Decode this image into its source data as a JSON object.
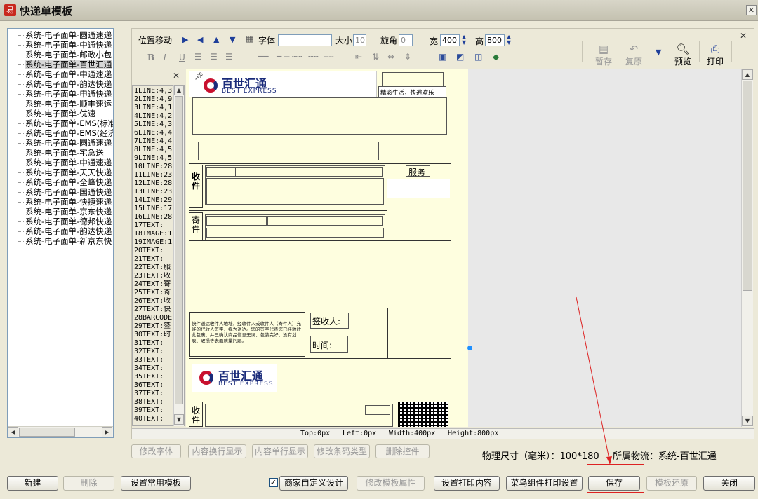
{
  "window": {
    "title": "快递单模板",
    "icon": "app-logo-icon",
    "close": "✕"
  },
  "templates": [
    "系统-电子面单-圆通速递",
    "系统-电子面单-中通快递",
    "系统-电子面单-邮政小包",
    "系统-电子面单-百世汇通",
    "系统-电子面单-中通速递",
    "系统-电子面单-韵达快递",
    "系统-电子面单-申通快递",
    "系统-电子面单-顺丰速运",
    "系统-电子面单-优速",
    "系统-电子面单-EMS(标准",
    "系统-电子面单-EMS(经济",
    "系统-电子面单-圆通速递",
    "系统-电子面单-宅急送",
    "系统-电子面单-中通速递",
    "系统-电子面单-天天快递",
    "系统-电子面单-全峰快递",
    "系统-电子面单-国通快递",
    "系统-电子面单-快捷速递",
    "系统-电子面单-京东快递",
    "系统-电子面单-德邦快递",
    "系统-电子面单-韵达快递",
    "系统-电子面单-新京东快"
  ],
  "toolbar": {
    "position_move": "位置移动",
    "font_label": "字体",
    "size_label": "大小",
    "size_value": "10",
    "rotation_label": "旋角",
    "rotation_value": "0",
    "width_label": "宽",
    "width_value": "400",
    "height_label": "高",
    "height_value": "800",
    "save": "暂存",
    "restore": "复原",
    "preview": "预览",
    "print": "打印"
  },
  "elements": [
    "1LINE:4,3",
    "2LINE:4,9",
    "3LINE:4,1",
    "4LINE:4,2",
    "5LINE:4,3",
    "6LINE:4,4",
    "7LINE:4,4",
    "8LINE:4,5",
    "9LINE:4,5",
    "10LINE:28",
    "11LINE:23",
    "12LINE:28",
    "13LINE:23",
    "14LINE:29",
    "15LINE:17",
    "16LINE:28",
    "17TEXT:",
    "18IMAGE:1",
    "19IMAGE:1",
    "20TEXT:",
    "21TEXT:",
    "22TEXT:服",
    "23TEXT:收",
    "24TEXT:寄",
    "25TEXT:寄",
    "26TEXT:收",
    "27TEXT:快",
    "28BARCODE",
    "29TEXT:签",
    "30TEXT:时",
    "31TEXT:",
    "32TEXT:",
    "33TEXT:",
    "34TEXT:",
    "35TEXT:",
    "36TEXT:",
    "37TEXT:",
    "38TEXT:",
    "39TEXT:",
    "40TEXT:"
  ],
  "label": {
    "logo_cn": "百世汇通",
    "logo_en": "BEST EXPRESS",
    "slogan": "精彩生活，快递欢乐",
    "service": "服务",
    "receiver_vertical": "收件",
    "sender_vertical": "寄件",
    "notice": "快件送达收件人地址，经收件人或收件人（寄件人）允许的代收人签字，视为送达。您的签字代表您已经验收此包裹，并已确认商品信息无误、包装完好、没有划痕、破损等表面质量问题。",
    "signer": "签收人:",
    "time": "时间:",
    "receiver_vertical2": "收件"
  },
  "status": {
    "top": "Top:0px",
    "left": "Left:0px",
    "width": "Width:400px",
    "height": "Height:800px"
  },
  "actions": {
    "modify_font": "修改字体",
    "wrap_display": "内容换行显示",
    "single_line": "内容单行显示",
    "barcode_type": "修改条码类型",
    "delete_control": "删除控件"
  },
  "info": {
    "physical_size_label": "物理尺寸（毫米）：",
    "physical_size_value": "100*180",
    "logistics_label": "所属物流：",
    "logistics_value": "系统-百世汇通"
  },
  "bottom": {
    "new": "新建",
    "delete": "删除",
    "set_common": "设置常用模板",
    "merchant_custom": "商家自定义设计",
    "merchant_checked": "✓",
    "modify_props": "修改模板属性",
    "print_content": "设置打印内容",
    "cainiao": "菜鸟组件打印设置",
    "save": "保存",
    "restore": "模板还原",
    "close": "关闭"
  },
  "colors": {
    "highlight": "#dd2222",
    "paper": "#fefedf",
    "brand": "#1a2b7a",
    "brand_red": "#c8102e"
  }
}
